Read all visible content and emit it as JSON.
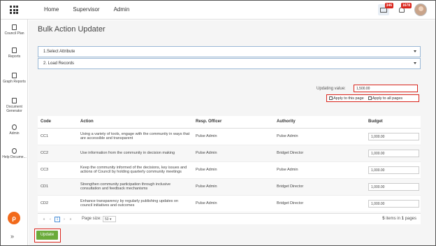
{
  "nav": {
    "home": "Home",
    "supervisor": "Supervisor",
    "admin": "Admin"
  },
  "badges": {
    "messages": "346",
    "notifications": "1678"
  },
  "sidebar": {
    "items": [
      {
        "label": "Council Plan"
      },
      {
        "label": "Reports"
      },
      {
        "label": "Graph Reports"
      },
      {
        "label": "Document Generator"
      },
      {
        "label": "Admin"
      },
      {
        "label": "Help Docume..."
      }
    ],
    "logo": "ρ",
    "expand": "»"
  },
  "page": {
    "title": "Bulk Action Updater"
  },
  "accordions": {
    "step1": "1.Select Attribute",
    "step2": "2. Load Records"
  },
  "update_value": {
    "label": "Updating value:",
    "value": "1,500.00"
  },
  "apply": {
    "this_page": "Apply to this page",
    "all_pages": "Apply to all pages"
  },
  "table": {
    "headers": {
      "code": "Code",
      "action": "Action",
      "officer": "Resp. Officer",
      "authority": "Authority",
      "budget": "Budget"
    },
    "rows": [
      {
        "code": "CC1",
        "action": "Using a variety of tools, engage with the community in ways that are accessible and transparent",
        "officer": "Pulse Admin",
        "authority": "Pulse Admin",
        "budget": "1,000.00"
      },
      {
        "code": "CC2",
        "action": "Use information from the community in decision making",
        "officer": "Pulse Admin",
        "authority": "Bridget Director",
        "budget": "1,000.00"
      },
      {
        "code": "CC3",
        "action": "Keep the community informed of the decisions, key issues and actions of Council by holding quarterly community meetings",
        "officer": "Pulse Admin",
        "authority": "Pulse Admin",
        "budget": "1,000.00"
      },
      {
        "code": "CD1",
        "action": "Strengthen community participation through inclusive consultation and feedback mechanisms",
        "officer": "Pulse Admin",
        "authority": "Bridget Director",
        "budget": "1,000.00"
      },
      {
        "code": "CD2",
        "action": "Enhance transparency by regularly publishing updates on council initiatives and outcomes",
        "officer": "Pulse Admin",
        "authority": "Bridget Director",
        "budget": "1,000.00"
      }
    ]
  },
  "pager": {
    "first": "«",
    "prev": "‹",
    "page": "1",
    "next": "›",
    "last": "»",
    "size_label": "Page size:",
    "size": "50",
    "info_count": "5",
    "info_mid": " items in ",
    "info_pages": "1",
    "info_end": " pages"
  },
  "update_button": "Update"
}
